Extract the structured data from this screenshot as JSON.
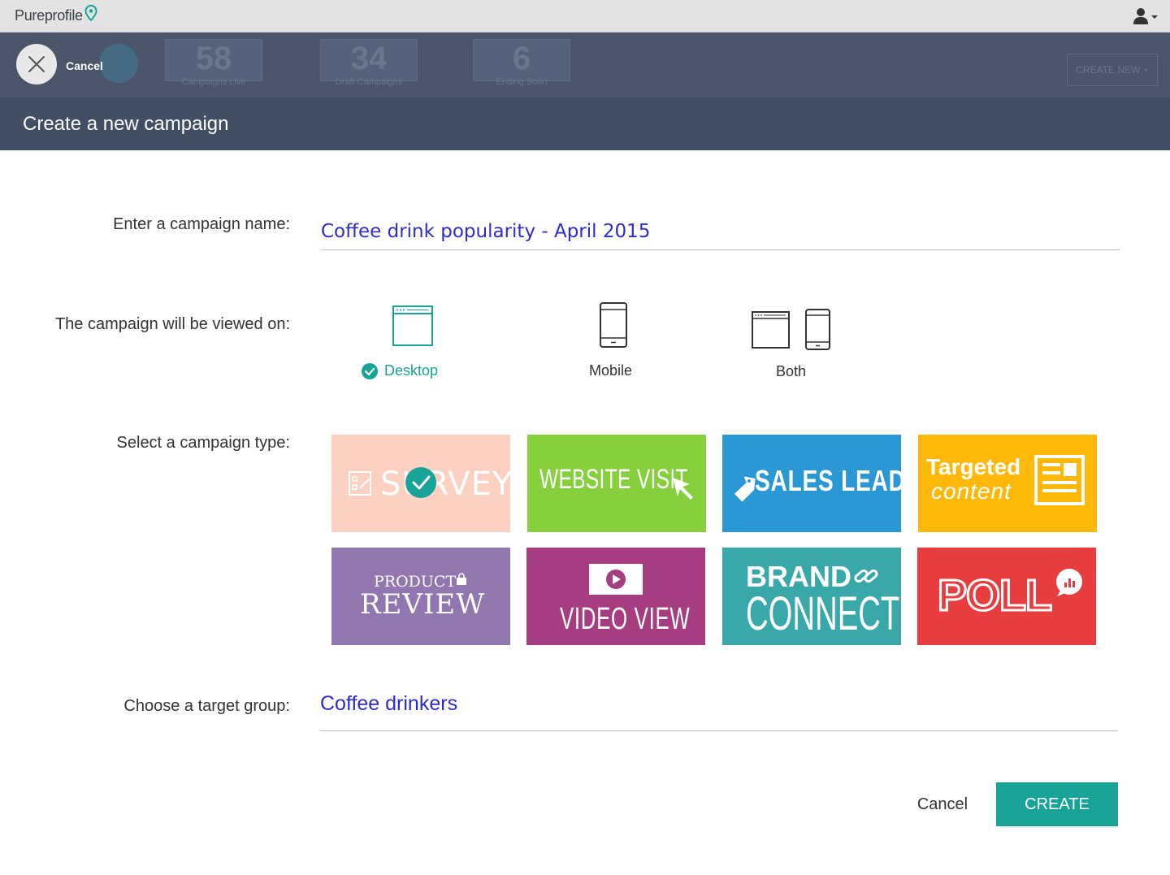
{
  "app": {
    "brand": "Pureprofile"
  },
  "background_header": {
    "cancel_label": "Cancel",
    "stats": [
      {
        "value": "58",
        "label": "Campaigns Live"
      },
      {
        "value": "34",
        "label": "Draft Campaigns"
      },
      {
        "value": "6",
        "label": "Ending Soon"
      }
    ],
    "create_new_label": "CREATE NEW +"
  },
  "modal": {
    "title": "Create a new campaign",
    "campaign_name": {
      "label": "Enter a campaign name:",
      "value": "Coffee drink popularity - April 2015"
    },
    "viewed_on": {
      "label": "The campaign will be viewed on:",
      "options": [
        {
          "label": "Desktop",
          "selected": true,
          "icon": "desktop-icon"
        },
        {
          "label": "Mobile",
          "selected": false,
          "icon": "mobile-icon"
        },
        {
          "label": "Both",
          "selected": false,
          "icon": "desktop-and-mobile-icon"
        }
      ]
    },
    "campaign_type": {
      "label": "Select a campaign type:",
      "tiles": [
        {
          "text": "SURVEY",
          "color": "#fdd1c1",
          "selected": true
        },
        {
          "text": "WEBSITE VISIT",
          "color": "#86d03d",
          "selected": false
        },
        {
          "text": "SALES LEAD",
          "color": "#2b98d6",
          "selected": false
        },
        {
          "text": "Targeted",
          "text2": "content",
          "color": "#feb80a",
          "selected": false
        },
        {
          "text": "PRODUCT",
          "text2": "REVIEW",
          "color": "#9176b0",
          "selected": false
        },
        {
          "text": "VIDEO VIEW",
          "color": "#a63d81",
          "selected": false
        },
        {
          "text": "BRAND",
          "text2": "CONNECT",
          "color": "#38a8a9",
          "selected": false
        },
        {
          "text": "POLL",
          "color": "#e83c3e",
          "selected": false
        }
      ]
    },
    "target_group": {
      "label": "Choose a target group:",
      "value": "Coffee drinkers"
    },
    "cancel_label": "Cancel",
    "create_label": "CREATE"
  },
  "colors": {
    "accent": "#17a398",
    "input_text": "#2f2ccf",
    "header": "#424e63"
  }
}
